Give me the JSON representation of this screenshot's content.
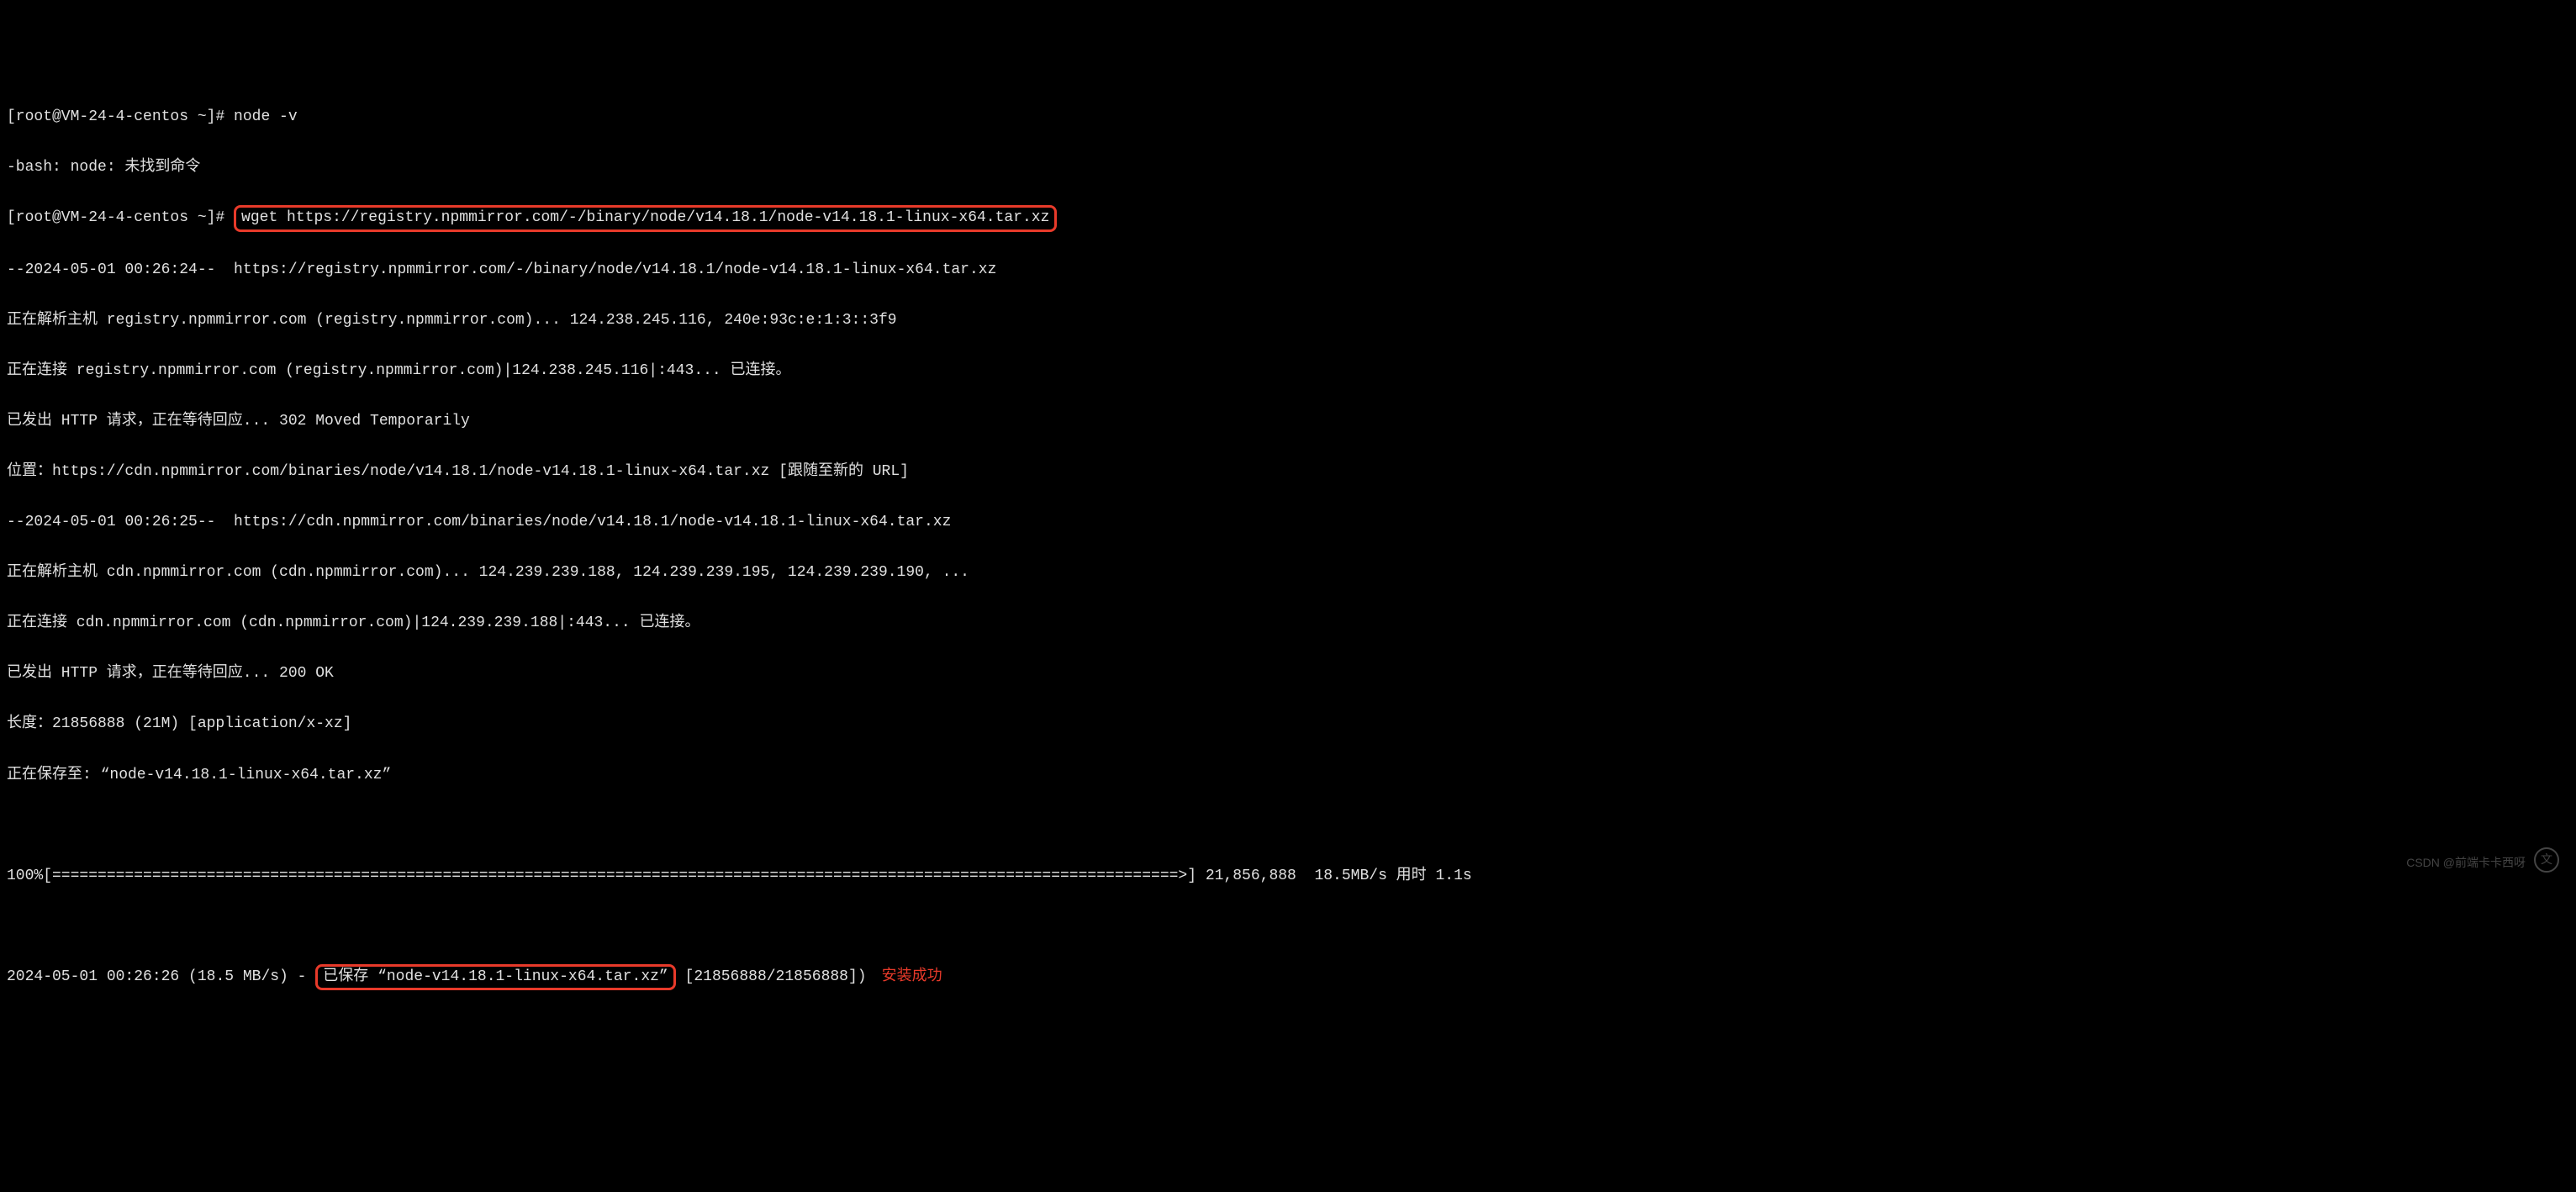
{
  "prompt1": "[root@VM-24-4-centos ~]# ",
  "cmd1": "node -v",
  "out1": "-bash: node: 未找到命令",
  "prompt2": "[root@VM-24-4-centos ~]# ",
  "cmd2": "wget https://registry.npmmirror.com/-/binary/node/v14.18.1/node-v14.18.1-linux-x64.tar.xz",
  "wget": {
    "l1": "--2024-05-01 00:26:24--  https://registry.npmmirror.com/-/binary/node/v14.18.1/node-v14.18.1-linux-x64.tar.xz",
    "l2": "正在解析主机 registry.npmmirror.com (registry.npmmirror.com)... 124.238.245.116, 240e:93c:e:1:3::3f9",
    "l3": "正在连接 registry.npmmirror.com (registry.npmmirror.com)|124.238.245.116|:443... 已连接。",
    "l4": "已发出 HTTP 请求，正在等待回应... 302 Moved Temporarily",
    "l5": "位置：https://cdn.npmmirror.com/binaries/node/v14.18.1/node-v14.18.1-linux-x64.tar.xz [跟随至新的 URL]",
    "l6": "--2024-05-01 00:26:25--  https://cdn.npmmirror.com/binaries/node/v14.18.1/node-v14.18.1-linux-x64.tar.xz",
    "l7": "正在解析主机 cdn.npmmirror.com (cdn.npmmirror.com)... 124.239.239.188, 124.239.239.195, 124.239.239.190, ...",
    "l8": "正在连接 cdn.npmmirror.com (cdn.npmmirror.com)|124.239.239.188|:443... 已连接。",
    "l9": "已发出 HTTP 请求，正在等待回应... 200 OK",
    "l10": "长度：21856888 (21M) [application/x-xz]",
    "l11": "正在保存至: “node-v14.18.1-linux-x64.tar.xz”"
  },
  "progress": "100%[============================================================================================================================>] 21,856,888  18.5MB/s 用时 1.1s",
  "final_prefix": "2024-05-01 00:26:26 (18.5 MB/s) - ",
  "final_saved": "已保存 “node-v14.18.1-linux-x64.tar.xz”",
  "final_suffix": " [21856888/21856888])",
  "annotation": "安装成功",
  "watermark": "CSDN @前端卡卡西呀",
  "watermark_icon": "文"
}
